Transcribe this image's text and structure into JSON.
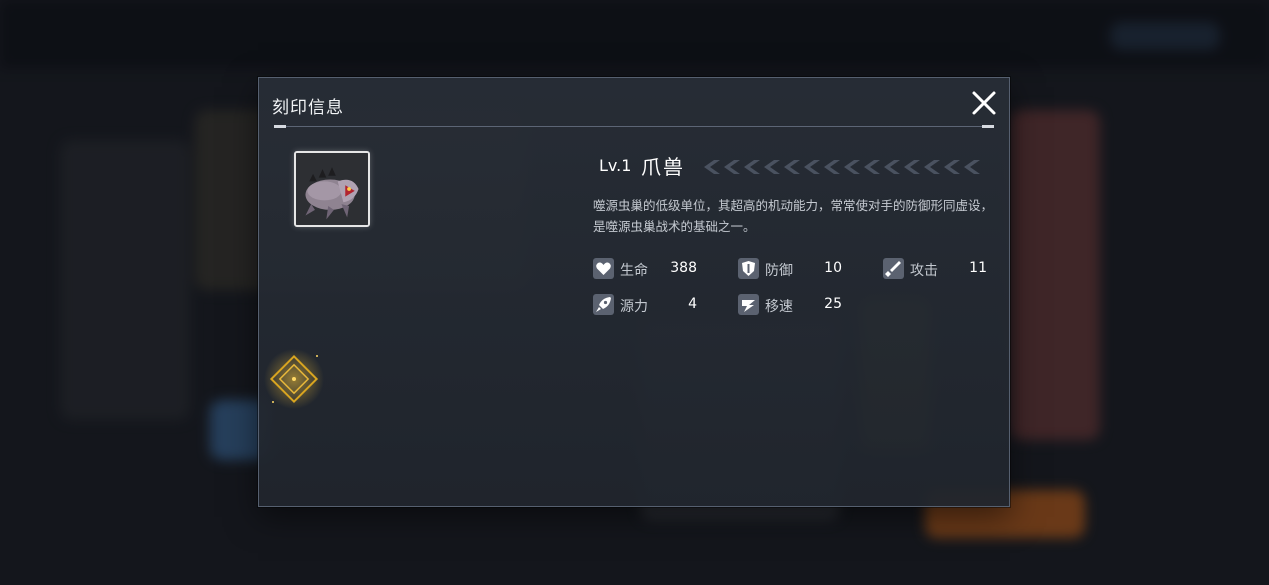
{
  "modal": {
    "title": "刻印信息",
    "close_icon": "close-icon"
  },
  "unit": {
    "level": "Lv.1",
    "name": "爪兽",
    "description": "噬源虫巢的低级单位，其超高的机动能力，常常使对手的防御形同虚设，是噬源虫巢战术的基础之一。",
    "portrait_icon": "claw-beast-portrait",
    "emblem_icon": "gold-diamond-emblem"
  },
  "stats": [
    {
      "icon": "heart-icon",
      "label": "生命",
      "value": "388"
    },
    {
      "icon": "shield-icon",
      "label": "防御",
      "value": "10"
    },
    {
      "icon": "sword-icon",
      "label": "攻击",
      "value": "11"
    },
    {
      "icon": "energy-icon",
      "label": "源力",
      "value": "4"
    },
    {
      "icon": "speed-icon",
      "label": "移速",
      "value": "25"
    }
  ],
  "colors": {
    "accent_gold": "#d9a520",
    "panel_border": "#566070"
  }
}
